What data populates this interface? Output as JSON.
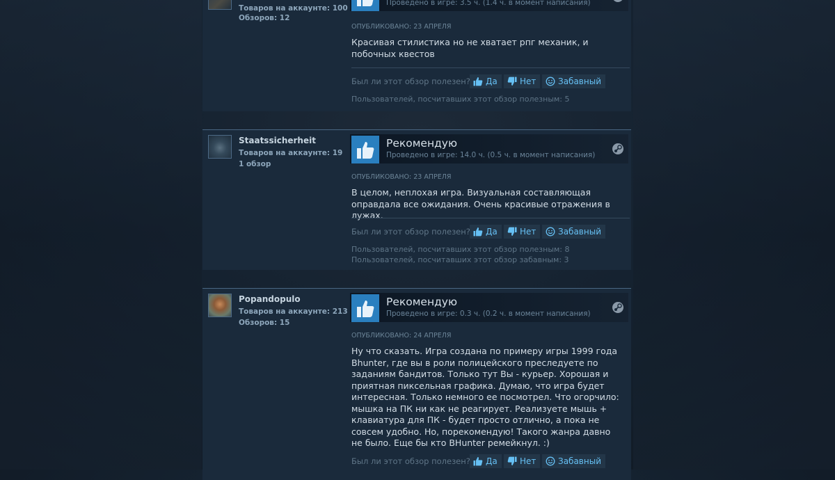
{
  "reviews": [
    {
      "author_name": "",
      "products_label": "Товаров на аккаунте: 100",
      "reviews_label": "Обзоров: 12",
      "vote_title": "",
      "hours": "Проведено в игре: 3.5 ч. (1.4 ч. в момент написания)",
      "posted": "Опубликовано: 23 апреля",
      "text": "Красивая стилистика но не хватает рпг механик, и побочных квестов",
      "helpful_question": "Был ли этот обзор полезен?",
      "yes_label": "Да",
      "no_label": "Нет",
      "funny_label": "Забавный",
      "stats": [
        "Пользователей, посчитавших этот обзор полезным: 5"
      ]
    },
    {
      "author_name": "Staatssicherheit",
      "products_label": "Товаров на аккаунте: 19",
      "reviews_label": "1 обзор",
      "vote_title": "Рекомендую",
      "hours": "Проведено в игре: 14.0 ч. (0.5 ч. в момент написания)",
      "posted": "Опубликовано: 23 апреля",
      "text": "В целом, неплохая игра. Визуальная составляющая оправдала все ожидания. Очень красивые отражения в лужах.",
      "helpful_question": "Был ли этот обзор полезен?",
      "yes_label": "Да",
      "no_label": "Нет",
      "funny_label": "Забавный",
      "stats": [
        "Пользователей, посчитавших этот обзор полезным: 8",
        "Пользователей, посчитавших этот обзор забавным: 3"
      ]
    },
    {
      "author_name": "Popandopulo",
      "products_label": "Товаров на аккаунте: 213",
      "reviews_label": "Обзоров: 15",
      "vote_title": "Рекомендую",
      "hours": "Проведено в игре: 0.3 ч. (0.2 ч. в момент написания)",
      "posted": "Опубликовано: 24 апреля",
      "text": "Ну что сказать. Игра создана по примеру игры 1999 года Bhunter, где вы в роли полицейского преследуете по заданиям бандитов. Только тут Вы - курьер. Хорошая и приятная пиксельная графика. Думаю, что игра будет интересная. Только немного ее посмотрел. Что огорчило: мышка на ПК ни как не реагирует. Реализуете мышь + клавиатура для ПК - будет просто отлично, а пока не совсем удобно. Но, порекомендую! Такого жанра давно не было. Еще бы кто BHunter ремейкнул. :)",
      "helpful_question": "Был ли этот обзор полезен?",
      "yes_label": "Да",
      "no_label": "Нет",
      "funny_label": "Забавный",
      "stats": []
    }
  ],
  "icons": {
    "thumb": "thumbs-up-icon",
    "steam": "steam-icon"
  },
  "colors": {
    "accent": "#66c0f4",
    "thumb_bg": "#2a7fbf",
    "card_bg": "#1a2a3b"
  }
}
